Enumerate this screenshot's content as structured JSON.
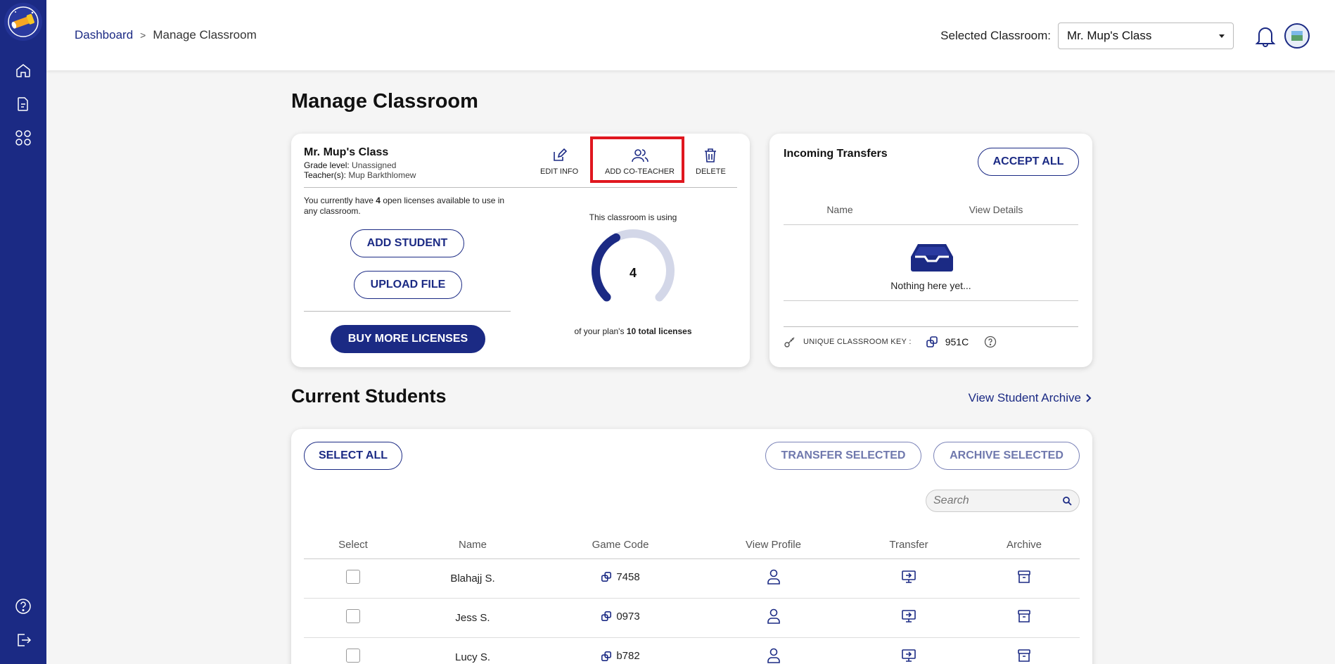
{
  "sidebar": {
    "items": [
      {
        "name": "home-icon"
      },
      {
        "name": "document-icon"
      },
      {
        "name": "apps-grid-icon"
      }
    ],
    "bottom": [
      {
        "name": "help-icon"
      },
      {
        "name": "logout-icon"
      }
    ]
  },
  "breadcrumb": {
    "root": "Dashboard",
    "sep": ">",
    "current": "Manage Classroom"
  },
  "header": {
    "selected_label": "Selected Classroom:",
    "selected_value": "Mr. Mup's Class"
  },
  "page_title": "Manage Classroom",
  "class_card": {
    "name": "Mr. Mup's Class",
    "grade_label": "Grade level:",
    "grade_value": "Unassigned",
    "teacher_label": "Teacher(s):",
    "teacher_value": "Mup Barkthlomew",
    "edit_label": "EDIT INFO",
    "add_coteacher_label": "ADD CO-TEACHER",
    "delete_label": "DELETE",
    "licenses_pre": "You currently have",
    "licenses_count": "4",
    "licenses_post": "open licenses available to use in any classroom.",
    "add_student": "ADD STUDENT",
    "upload_file": "UPLOAD FILE",
    "buy_more": "BUY MORE LICENSES",
    "using_text": "This classroom is using",
    "used": "4",
    "total_pre": "of your plan's",
    "total_strong": "10 total licenses",
    "gauge_fraction": 0.4
  },
  "transfers": {
    "title": "Incoming Transfers",
    "accept_all": "ACCEPT ALL",
    "col_name": "Name",
    "col_details": "View Details",
    "empty": "Nothing here yet...",
    "key_label": "UNIQUE CLASSROOM KEY :",
    "key_value": "951C"
  },
  "students_title": "Current Students",
  "archive_link": "View Student Archive",
  "students": {
    "select_all": "SELECT ALL",
    "transfer_selected": "TRANSFER SELECTED",
    "archive_selected": "ARCHIVE SELECTED",
    "search_placeholder": "Search",
    "columns": [
      "Select",
      "Name",
      "Game Code",
      "View Profile",
      "Transfer",
      "Archive"
    ],
    "rows": [
      {
        "name": "Blahajj S.",
        "code": "7458"
      },
      {
        "name": "Jess S.",
        "code": "0973"
      },
      {
        "name": "Lucy S.",
        "code": "b782"
      }
    ]
  },
  "colors": {
    "brand": "#1b2a84",
    "highlight": "#e0171f"
  }
}
